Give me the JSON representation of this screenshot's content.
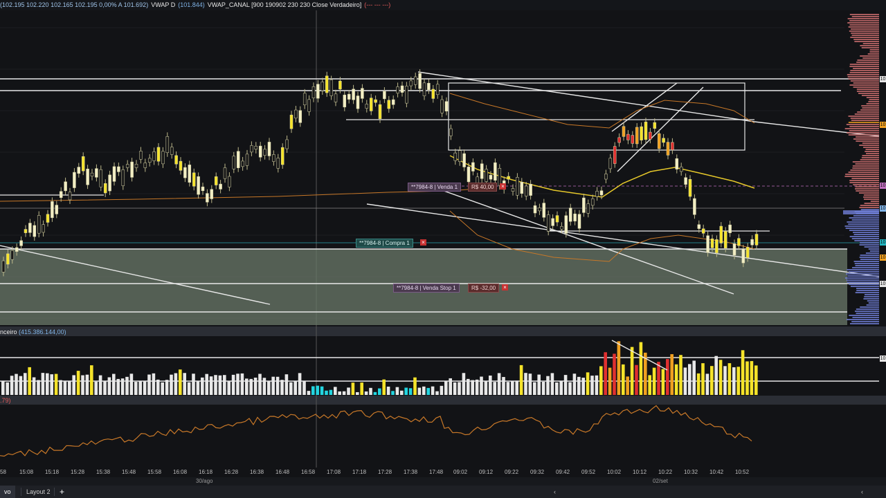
{
  "header": {
    "quote": "(102.195  102.220  102.165  102.195  0,00%  A 101.692)",
    "vwap_d_label": "VWAP D",
    "vwap_d_value": "(101.844)",
    "vwap_canal_label": "VWAP_CANAL [900 190902 230 230 Close Verdadeiro]",
    "vwap_canal_value": "(--- --- ---)"
  },
  "volume_panel": {
    "label": "nceiro",
    "value": "(415.386.144,00)"
  },
  "indicator_panel": {
    "value": ".79)"
  },
  "orders": [
    {
      "text": "**7984-8 | Venda 1",
      "pnl": "R$ 40,00",
      "close": "×"
    },
    {
      "text": "**7984-8 | Compra 1",
      "close": "×"
    },
    {
      "text": "**7984-8 | Venda Stop 1",
      "pnl": "R$ -32,00",
      "close": "×"
    }
  ],
  "time_axis": [
    "58",
    "15:08",
    "15:18",
    "15:28",
    "15:38",
    "15:48",
    "15:58",
    "16:08",
    "16:18",
    "16:28",
    "16:38",
    "16:48",
    "16:58",
    "17:08",
    "17:18",
    "17:28",
    "17:38",
    "17:48",
    "09:02",
    "09:12",
    "09:22",
    "09:32",
    "09:42",
    "09:52",
    "10:02",
    "10:12",
    "10:22",
    "10:32",
    "10:42",
    "10:52"
  ],
  "date_axis": [
    "30/ago",
    "02/set"
  ],
  "tabs": {
    "active": "vo",
    "second": "Layout 2",
    "add": "+"
  },
  "nav": {
    "left": "‹",
    "right": "‹"
  },
  "price_tags": [
    "10",
    "10",
    "10",
    "10",
    "10",
    "10",
    "10",
    "10"
  ],
  "colors": {
    "bg": "#121316",
    "bull": "#f2eec4",
    "bear": "#1a1a1a",
    "yellow": "#f5e32a",
    "orange": "#f0a020",
    "red": "#e03030",
    "cyan": "#23d5e0",
    "zone": "#6b7a6a",
    "vwap_orange": "#c87828",
    "vwap_yellow": "#e6c82a"
  }
}
